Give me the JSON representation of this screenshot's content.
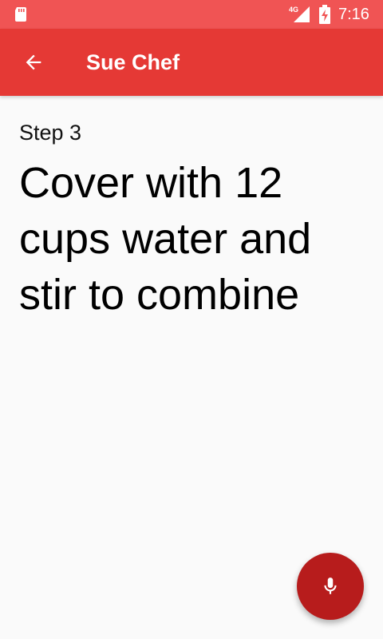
{
  "status_bar": {
    "network": "4G",
    "time": "7:16",
    "icons": [
      "sd-card-icon",
      "signal-icon",
      "battery-charging-icon"
    ]
  },
  "app_bar": {
    "title": "Sue Chef",
    "back_icon": "arrow-back-icon"
  },
  "step": {
    "label": "Step 3",
    "instruction": "Cover with 12 cups water and stir to combine"
  },
  "fab": {
    "icon": "microphone-icon"
  },
  "colors": {
    "status_bar": "#f05454",
    "app_bar": "#e53935",
    "fab": "#b71c1c",
    "background": "#fafafa"
  }
}
